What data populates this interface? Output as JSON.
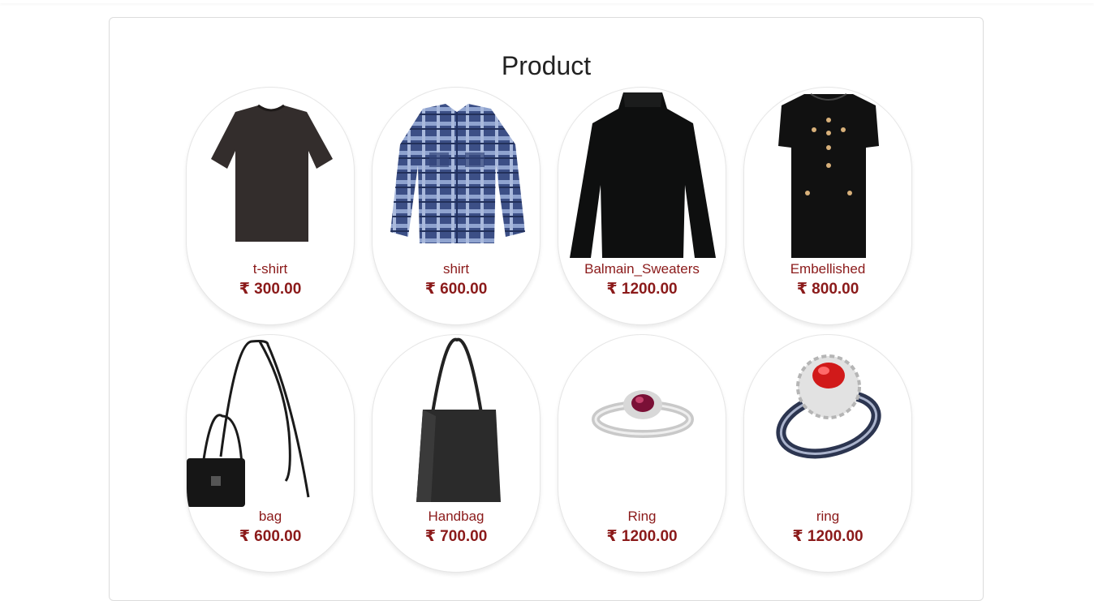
{
  "page": {
    "title": "Product"
  },
  "colors": {
    "accent": "#8b1a1a",
    "text": "#222222",
    "border": "#dcdcdc"
  },
  "products": [
    {
      "name": "t-shirt",
      "price": "₹ 300.00",
      "image": "black-tshirt-image"
    },
    {
      "name": "shirt",
      "price": "₹ 600.00",
      "image": "blue-plaid-shirt-image"
    },
    {
      "name": "Balmain_Sweaters",
      "price": "₹ 1200.00",
      "image": "black-sweater-image"
    },
    {
      "name": "Embellished",
      "price": "₹ 800.00",
      "image": "black-dress-image"
    },
    {
      "name": "bag",
      "price": "₹ 600.00",
      "image": "black-bag-image"
    },
    {
      "name": "Handbag",
      "price": "₹ 700.00",
      "image": "black-tote-image"
    },
    {
      "name": "Ring",
      "price": "₹ 1200.00",
      "image": "ruby-ring-image"
    },
    {
      "name": "ring",
      "price": "₹ 1200.00",
      "image": "red-stone-ring-image"
    }
  ]
}
